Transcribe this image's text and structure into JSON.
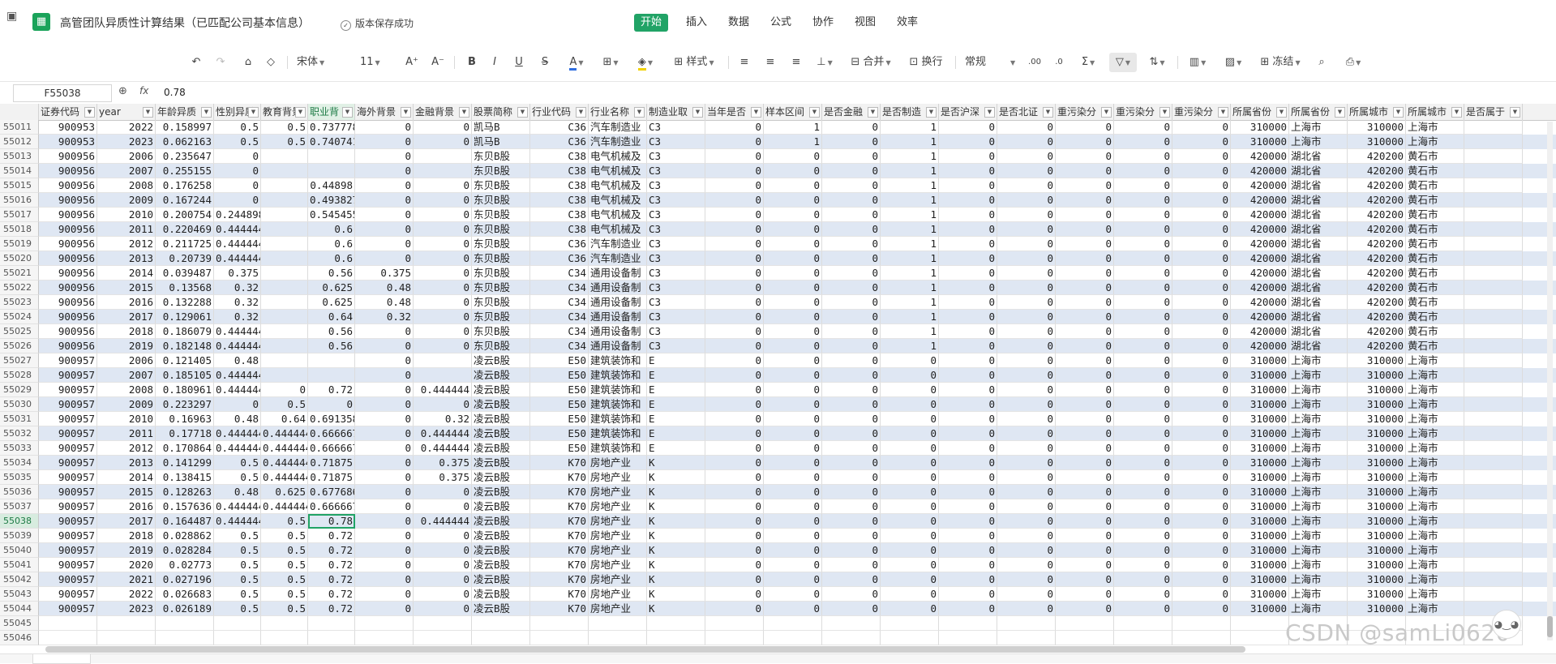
{
  "titlebar": {
    "doc_title": "高管团队异质性计算结果（已匹配公司基本信息）",
    "save_status": "版本保存成功",
    "menus": [
      "开始",
      "插入",
      "数据",
      "公式",
      "协作",
      "视图",
      "效率"
    ],
    "active_menu": "开始"
  },
  "toolbar": {
    "font_name": "宋体",
    "font_size": "11",
    "style_label": "样式",
    "merge_label": "合并",
    "wrap_label": "换行",
    "number_format": "常规",
    "freeze_label": "冻结"
  },
  "formula_bar": {
    "cell_ref": "F55038",
    "fx": "fx",
    "value": "0.78"
  },
  "columns": [
    "证券代码",
    "year",
    "年龄异质",
    "性别异质",
    "教育背景",
    "职业背",
    "海外背景",
    "金融背景",
    "股票简称",
    "行业代码",
    "行业名称",
    "制造业取",
    "当年是否",
    "样本区间",
    "是否金融",
    "是否制造",
    "是否沪深",
    "是否北证",
    "重污染分",
    "重污染分",
    "重污染分",
    "所属省份",
    "所属省份",
    "所属城市",
    "所属城市",
    "是否属于"
  ],
  "rows": [
    [
      "55011",
      "900953",
      "2022",
      "0.158997",
      "0.5",
      "0.5",
      "0.737778",
      "0",
      "0",
      "凯马B",
      "C36",
      "汽车制造业",
      "C3",
      "0",
      "1",
      "0",
      "1",
      "0",
      "0",
      "0",
      "0",
      "0",
      "310000",
      "上海市",
      "310000",
      "上海市"
    ],
    [
      "55012",
      "900953",
      "2023",
      "0.062163",
      "0.5",
      "0.5",
      "0.740741",
      "0",
      "0",
      "凯马B",
      "C36",
      "汽车制造业",
      "C3",
      "0",
      "1",
      "0",
      "1",
      "0",
      "0",
      "0",
      "0",
      "0",
      "310000",
      "上海市",
      "310000",
      "上海市"
    ],
    [
      "55013",
      "900956",
      "2006",
      "0.235647",
      "0",
      "",
      "",
      "0",
      "",
      "东贝B股",
      "C38",
      "电气机械及",
      "C3",
      "0",
      "0",
      "0",
      "1",
      "0",
      "0",
      "0",
      "0",
      "0",
      "420000",
      "湖北省",
      "420200",
      "黄石市"
    ],
    [
      "55014",
      "900956",
      "2007",
      "0.255155",
      "0",
      "",
      "",
      "0",
      "",
      "东贝B股",
      "C38",
      "电气机械及",
      "C3",
      "0",
      "0",
      "0",
      "1",
      "0",
      "0",
      "0",
      "0",
      "0",
      "420000",
      "湖北省",
      "420200",
      "黄石市"
    ],
    [
      "55015",
      "900956",
      "2008",
      "0.176258",
      "0",
      "",
      "0.44898",
      "0",
      "0",
      "东贝B股",
      "C38",
      "电气机械及",
      "C3",
      "0",
      "0",
      "0",
      "1",
      "0",
      "0",
      "0",
      "0",
      "0",
      "420000",
      "湖北省",
      "420200",
      "黄石市"
    ],
    [
      "55016",
      "900956",
      "2009",
      "0.167244",
      "0",
      "",
      "0.493827",
      "0",
      "0",
      "东贝B股",
      "C38",
      "电气机械及",
      "C3",
      "0",
      "0",
      "0",
      "1",
      "0",
      "0",
      "0",
      "0",
      "0",
      "420000",
      "湖北省",
      "420200",
      "黄石市"
    ],
    [
      "55017",
      "900956",
      "2010",
      "0.200754",
      "0.244898",
      "",
      "0.545455",
      "0",
      "0",
      "东贝B股",
      "C38",
      "电气机械及",
      "C3",
      "0",
      "0",
      "0",
      "1",
      "0",
      "0",
      "0",
      "0",
      "0",
      "420000",
      "湖北省",
      "420200",
      "黄石市"
    ],
    [
      "55018",
      "900956",
      "2011",
      "0.220469",
      "0.444444",
      "",
      "0.6",
      "0",
      "0",
      "东贝B股",
      "C38",
      "电气机械及",
      "C3",
      "0",
      "0",
      "0",
      "1",
      "0",
      "0",
      "0",
      "0",
      "0",
      "420000",
      "湖北省",
      "420200",
      "黄石市"
    ],
    [
      "55019",
      "900956",
      "2012",
      "0.211725",
      "0.444444",
      "",
      "0.6",
      "0",
      "0",
      "东贝B股",
      "C36",
      "汽车制造业",
      "C3",
      "0",
      "0",
      "0",
      "1",
      "0",
      "0",
      "0",
      "0",
      "0",
      "420000",
      "湖北省",
      "420200",
      "黄石市"
    ],
    [
      "55020",
      "900956",
      "2013",
      "0.20739",
      "0.444444",
      "",
      "0.6",
      "0",
      "0",
      "东贝B股",
      "C36",
      "汽车制造业",
      "C3",
      "0",
      "0",
      "0",
      "1",
      "0",
      "0",
      "0",
      "0",
      "0",
      "420000",
      "湖北省",
      "420200",
      "黄石市"
    ],
    [
      "55021",
      "900956",
      "2014",
      "0.039487",
      "0.375",
      "",
      "0.56",
      "0.375",
      "0",
      "东贝B股",
      "C34",
      "通用设备制",
      "C3",
      "0",
      "0",
      "0",
      "1",
      "0",
      "0",
      "0",
      "0",
      "0",
      "420000",
      "湖北省",
      "420200",
      "黄石市"
    ],
    [
      "55022",
      "900956",
      "2015",
      "0.13568",
      "0.32",
      "",
      "0.625",
      "0.48",
      "0",
      "东贝B股",
      "C34",
      "通用设备制",
      "C3",
      "0",
      "0",
      "0",
      "1",
      "0",
      "0",
      "0",
      "0",
      "0",
      "420000",
      "湖北省",
      "420200",
      "黄石市"
    ],
    [
      "55023",
      "900956",
      "2016",
      "0.132288",
      "0.32",
      "",
      "0.625",
      "0.48",
      "0",
      "东贝B股",
      "C34",
      "通用设备制",
      "C3",
      "0",
      "0",
      "0",
      "1",
      "0",
      "0",
      "0",
      "0",
      "0",
      "420000",
      "湖北省",
      "420200",
      "黄石市"
    ],
    [
      "55024",
      "900956",
      "2017",
      "0.129061",
      "0.32",
      "",
      "0.64",
      "0.32",
      "0",
      "东贝B股",
      "C34",
      "通用设备制",
      "C3",
      "0",
      "0",
      "0",
      "1",
      "0",
      "0",
      "0",
      "0",
      "0",
      "420000",
      "湖北省",
      "420200",
      "黄石市"
    ],
    [
      "55025",
      "900956",
      "2018",
      "0.186079",
      "0.444444",
      "",
      "0.56",
      "0",
      "0",
      "东贝B股",
      "C34",
      "通用设备制",
      "C3",
      "0",
      "0",
      "0",
      "1",
      "0",
      "0",
      "0",
      "0",
      "0",
      "420000",
      "湖北省",
      "420200",
      "黄石市"
    ],
    [
      "55026",
      "900956",
      "2019",
      "0.182148",
      "0.444444",
      "",
      "0.56",
      "0",
      "0",
      "东贝B股",
      "C34",
      "通用设备制",
      "C3",
      "0",
      "0",
      "0",
      "1",
      "0",
      "0",
      "0",
      "0",
      "0",
      "420000",
      "湖北省",
      "420200",
      "黄石市"
    ],
    [
      "55027",
      "900957",
      "2006",
      "0.121405",
      "0.48",
      "",
      "",
      "0",
      "",
      "凌云B股",
      "E50",
      "建筑装饰和",
      "E",
      "0",
      "0",
      "0",
      "0",
      "0",
      "0",
      "0",
      "0",
      "0",
      "310000",
      "上海市",
      "310000",
      "上海市"
    ],
    [
      "55028",
      "900957",
      "2007",
      "0.185105",
      "0.444444",
      "",
      "",
      "0",
      "",
      "凌云B股",
      "E50",
      "建筑装饰和",
      "E",
      "0",
      "0",
      "0",
      "0",
      "0",
      "0",
      "0",
      "0",
      "0",
      "310000",
      "上海市",
      "310000",
      "上海市"
    ],
    [
      "55029",
      "900957",
      "2008",
      "0.180961",
      "0.444444",
      "0",
      "0.72",
      "0",
      "0.444444",
      "凌云B股",
      "E50",
      "建筑装饰和",
      "E",
      "0",
      "0",
      "0",
      "0",
      "0",
      "0",
      "0",
      "0",
      "0",
      "310000",
      "上海市",
      "310000",
      "上海市"
    ],
    [
      "55030",
      "900957",
      "2009",
      "0.223297",
      "0",
      "0.5",
      "0",
      "0",
      "0",
      "凌云B股",
      "E50",
      "建筑装饰和",
      "E",
      "0",
      "0",
      "0",
      "0",
      "0",
      "0",
      "0",
      "0",
      "0",
      "310000",
      "上海市",
      "310000",
      "上海市"
    ],
    [
      "55031",
      "900957",
      "2010",
      "0.16963",
      "0.48",
      "0.64",
      "0.691358",
      "0",
      "0.32",
      "凌云B股",
      "E50",
      "建筑装饰和",
      "E",
      "0",
      "0",
      "0",
      "0",
      "0",
      "0",
      "0",
      "0",
      "0",
      "310000",
      "上海市",
      "310000",
      "上海市"
    ],
    [
      "55032",
      "900957",
      "2011",
      "0.17718",
      "0.444444",
      "0.444444",
      "0.666667",
      "0",
      "0.444444",
      "凌云B股",
      "E50",
      "建筑装饰和",
      "E",
      "0",
      "0",
      "0",
      "0",
      "0",
      "0",
      "0",
      "0",
      "0",
      "310000",
      "上海市",
      "310000",
      "上海市"
    ],
    [
      "55033",
      "900957",
      "2012",
      "0.170864",
      "0.444444",
      "0.444444",
      "0.666667",
      "0",
      "0.444444",
      "凌云B股",
      "E50",
      "建筑装饰和",
      "E",
      "0",
      "0",
      "0",
      "0",
      "0",
      "0",
      "0",
      "0",
      "0",
      "310000",
      "上海市",
      "310000",
      "上海市"
    ],
    [
      "55034",
      "900957",
      "2013",
      "0.141299",
      "0.5",
      "0.444444",
      "0.71875",
      "0",
      "0.375",
      "凌云B股",
      "K70",
      "房地产业",
      "K",
      "0",
      "0",
      "0",
      "0",
      "0",
      "0",
      "0",
      "0",
      "0",
      "310000",
      "上海市",
      "310000",
      "上海市"
    ],
    [
      "55035",
      "900957",
      "2014",
      "0.138415",
      "0.5",
      "0.444444",
      "0.71875",
      "0",
      "0.375",
      "凌云B股",
      "K70",
      "房地产业",
      "K",
      "0",
      "0",
      "0",
      "0",
      "0",
      "0",
      "0",
      "0",
      "0",
      "310000",
      "上海市",
      "310000",
      "上海市"
    ],
    [
      "55036",
      "900957",
      "2015",
      "0.128263",
      "0.48",
      "0.625",
      "0.677686",
      "0",
      "0",
      "凌云B股",
      "K70",
      "房地产业",
      "K",
      "0",
      "0",
      "0",
      "0",
      "0",
      "0",
      "0",
      "0",
      "0",
      "310000",
      "上海市",
      "310000",
      "上海市"
    ],
    [
      "55037",
      "900957",
      "2016",
      "0.157636",
      "0.444444",
      "0.444444",
      "0.666667",
      "0",
      "0",
      "凌云B股",
      "K70",
      "房地产业",
      "K",
      "0",
      "0",
      "0",
      "0",
      "0",
      "0",
      "0",
      "0",
      "0",
      "310000",
      "上海市",
      "310000",
      "上海市"
    ],
    [
      "55038",
      "900957",
      "2017",
      "0.164487",
      "0.444444",
      "0.5",
      "0.78",
      "0",
      "0.444444",
      "凌云B股",
      "K70",
      "房地产业",
      "K",
      "0",
      "0",
      "0",
      "0",
      "0",
      "0",
      "0",
      "0",
      "0",
      "310000",
      "上海市",
      "310000",
      "上海市"
    ],
    [
      "55039",
      "900957",
      "2018",
      "0.028862",
      "0.5",
      "0.5",
      "0.72",
      "0",
      "0",
      "凌云B股",
      "K70",
      "房地产业",
      "K",
      "0",
      "0",
      "0",
      "0",
      "0",
      "0",
      "0",
      "0",
      "0",
      "310000",
      "上海市",
      "310000",
      "上海市"
    ],
    [
      "55040",
      "900957",
      "2019",
      "0.028284",
      "0.5",
      "0.5",
      "0.72",
      "0",
      "0",
      "凌云B股",
      "K70",
      "房地产业",
      "K",
      "0",
      "0",
      "0",
      "0",
      "0",
      "0",
      "0",
      "0",
      "0",
      "310000",
      "上海市",
      "310000",
      "上海市"
    ],
    [
      "55041",
      "900957",
      "2020",
      "0.02773",
      "0.5",
      "0.5",
      "0.72",
      "0",
      "0",
      "凌云B股",
      "K70",
      "房地产业",
      "K",
      "0",
      "0",
      "0",
      "0",
      "0",
      "0",
      "0",
      "0",
      "0",
      "310000",
      "上海市",
      "310000",
      "上海市"
    ],
    [
      "55042",
      "900957",
      "2021",
      "0.027196",
      "0.5",
      "0.5",
      "0.72",
      "0",
      "0",
      "凌云B股",
      "K70",
      "房地产业",
      "K",
      "0",
      "0",
      "0",
      "0",
      "0",
      "0",
      "0",
      "0",
      "0",
      "310000",
      "上海市",
      "310000",
      "上海市"
    ],
    [
      "55043",
      "900957",
      "2022",
      "0.026683",
      "0.5",
      "0.5",
      "0.72",
      "0",
      "0",
      "凌云B股",
      "K70",
      "房地产业",
      "K",
      "0",
      "0",
      "0",
      "0",
      "0",
      "0",
      "0",
      "0",
      "0",
      "310000",
      "上海市",
      "310000",
      "上海市"
    ],
    [
      "55044",
      "900957",
      "2023",
      "0.026189",
      "0.5",
      "0.5",
      "0.72",
      "0",
      "0",
      "凌云B股",
      "K70",
      "房地产业",
      "K",
      "0",
      "0",
      "0",
      "0",
      "0",
      "0",
      "0",
      "0",
      "0",
      "310000",
      "上海市",
      "310000",
      "上海市"
    ],
    [
      "55045"
    ],
    [
      "55046"
    ]
  ],
  "watermark": "CSDN @samLi0620",
  "colors": {
    "accent": "#21a366",
    "stripe": "#dfe7f3"
  }
}
